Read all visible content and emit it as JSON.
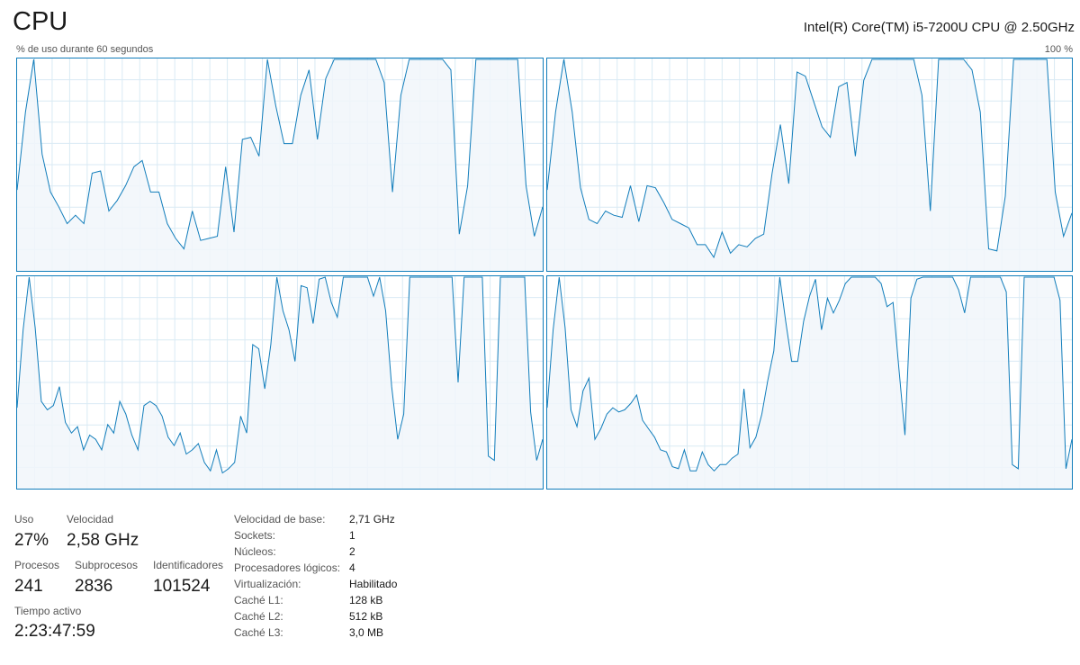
{
  "header": {
    "title": "CPU",
    "model": "Intel(R) Core(TM) i5-7200U CPU @ 2.50GHz",
    "axis_left": "% de uso durante 60 segundos",
    "axis_right": "100 %"
  },
  "colors": {
    "line": "#117dbb",
    "fill": "#f1f6fa",
    "grid": "#d9eaf4",
    "border": "#117dbb"
  },
  "graphs": [
    {
      "name": "logical-processor-0",
      "values": [
        38,
        75,
        100,
        55,
        37,
        30,
        22,
        26,
        22,
        46,
        47,
        28,
        33,
        40,
        49,
        52,
        37,
        37,
        22,
        15,
        10,
        28,
        14,
        15,
        16,
        49,
        18,
        62,
        63,
        54,
        100,
        78,
        60,
        60,
        83,
        95,
        62,
        91,
        100,
        100,
        100,
        100,
        100,
        100,
        89,
        37,
        83,
        100,
        100,
        100,
        100,
        100,
        95,
        17,
        40,
        100,
        100,
        100,
        100,
        100,
        100,
        40,
        16,
        30
      ]
    },
    {
      "name": "logical-processor-1",
      "values": [
        38,
        75,
        100,
        75,
        39,
        24,
        22,
        28,
        26,
        25,
        40,
        23,
        40,
        39,
        32,
        24,
        22,
        20,
        12,
        12,
        6,
        18,
        8,
        12,
        11,
        15,
        17,
        46,
        69,
        41,
        94,
        92,
        80,
        68,
        63,
        87,
        89,
        54,
        90,
        100,
        100,
        100,
        100,
        100,
        100,
        83,
        28,
        100,
        100,
        100,
        100,
        95,
        75,
        10,
        9,
        35,
        100,
        100,
        100,
        100,
        100,
        37,
        16,
        27
      ]
    },
    {
      "name": "logical-processor-2",
      "values": [
        38,
        75,
        100,
        76,
        41,
        37,
        39,
        48,
        31,
        26,
        29,
        18,
        25,
        23,
        18,
        30,
        26,
        41,
        35,
        25,
        18,
        39,
        41,
        39,
        34,
        24,
        20,
        26,
        16,
        18,
        21,
        12,
        8,
        18,
        7,
        9,
        12,
        34,
        26,
        68,
        66,
        47,
        68,
        100,
        84,
        75,
        60,
        96,
        95,
        78,
        99,
        100,
        88,
        81,
        100,
        100,
        100,
        100,
        100,
        91,
        100,
        84,
        48,
        23,
        35,
        100,
        100,
        100,
        100,
        100,
        100,
        100,
        100,
        50,
        100,
        100,
        100,
        100,
        15,
        13,
        100,
        100,
        100,
        100,
        100,
        36,
        13,
        23
      ]
    },
    {
      "name": "logical-processor-3",
      "values": [
        38,
        75,
        100,
        76,
        37,
        29,
        46,
        52,
        23,
        28,
        35,
        38,
        36,
        37,
        40,
        44,
        32,
        28,
        24,
        18,
        17,
        10,
        9,
        18,
        8,
        8,
        17,
        11,
        8,
        11,
        11,
        14,
        16,
        47,
        19,
        24,
        35,
        51,
        65,
        100,
        79,
        60,
        60,
        79,
        91,
        99,
        75,
        90,
        83,
        89,
        97,
        100,
        100,
        100,
        100,
        100,
        97,
        86,
        88,
        56,
        25,
        90,
        99,
        100,
        100,
        100,
        100,
        100,
        100,
        94,
        83,
        100,
        100,
        100,
        100,
        100,
        100,
        93,
        11,
        9,
        100,
        100,
        100,
        100,
        100,
        100,
        89,
        9,
        23
      ]
    }
  ],
  "stats": {
    "uso_label": "Uso",
    "uso_value": "27%",
    "velocidad_label": "Velocidad",
    "velocidad_value": "2,58 GHz",
    "procesos_label": "Procesos",
    "procesos_value": "241",
    "subprocesos_label": "Subprocesos",
    "subprocesos_value": "2836",
    "identificadores_label": "Identificadores",
    "identificadores_value": "101524",
    "tiempo_label": "Tiempo activo",
    "tiempo_value": "2:23:47:59"
  },
  "specs": [
    {
      "key": "Velocidad de base:",
      "value": "2,71 GHz"
    },
    {
      "key": "Sockets:",
      "value": "1"
    },
    {
      "key": "Núcleos:",
      "value": "2"
    },
    {
      "key": "Procesadores lógicos:",
      "value": "4"
    },
    {
      "key": "Virtualización:",
      "value": "Habilitado"
    },
    {
      "key": "Caché L1:",
      "value": "128 kB"
    },
    {
      "key": "Caché L2:",
      "value": "512 kB"
    },
    {
      "key": "Caché L3:",
      "value": "3,0 MB"
    }
  ]
}
